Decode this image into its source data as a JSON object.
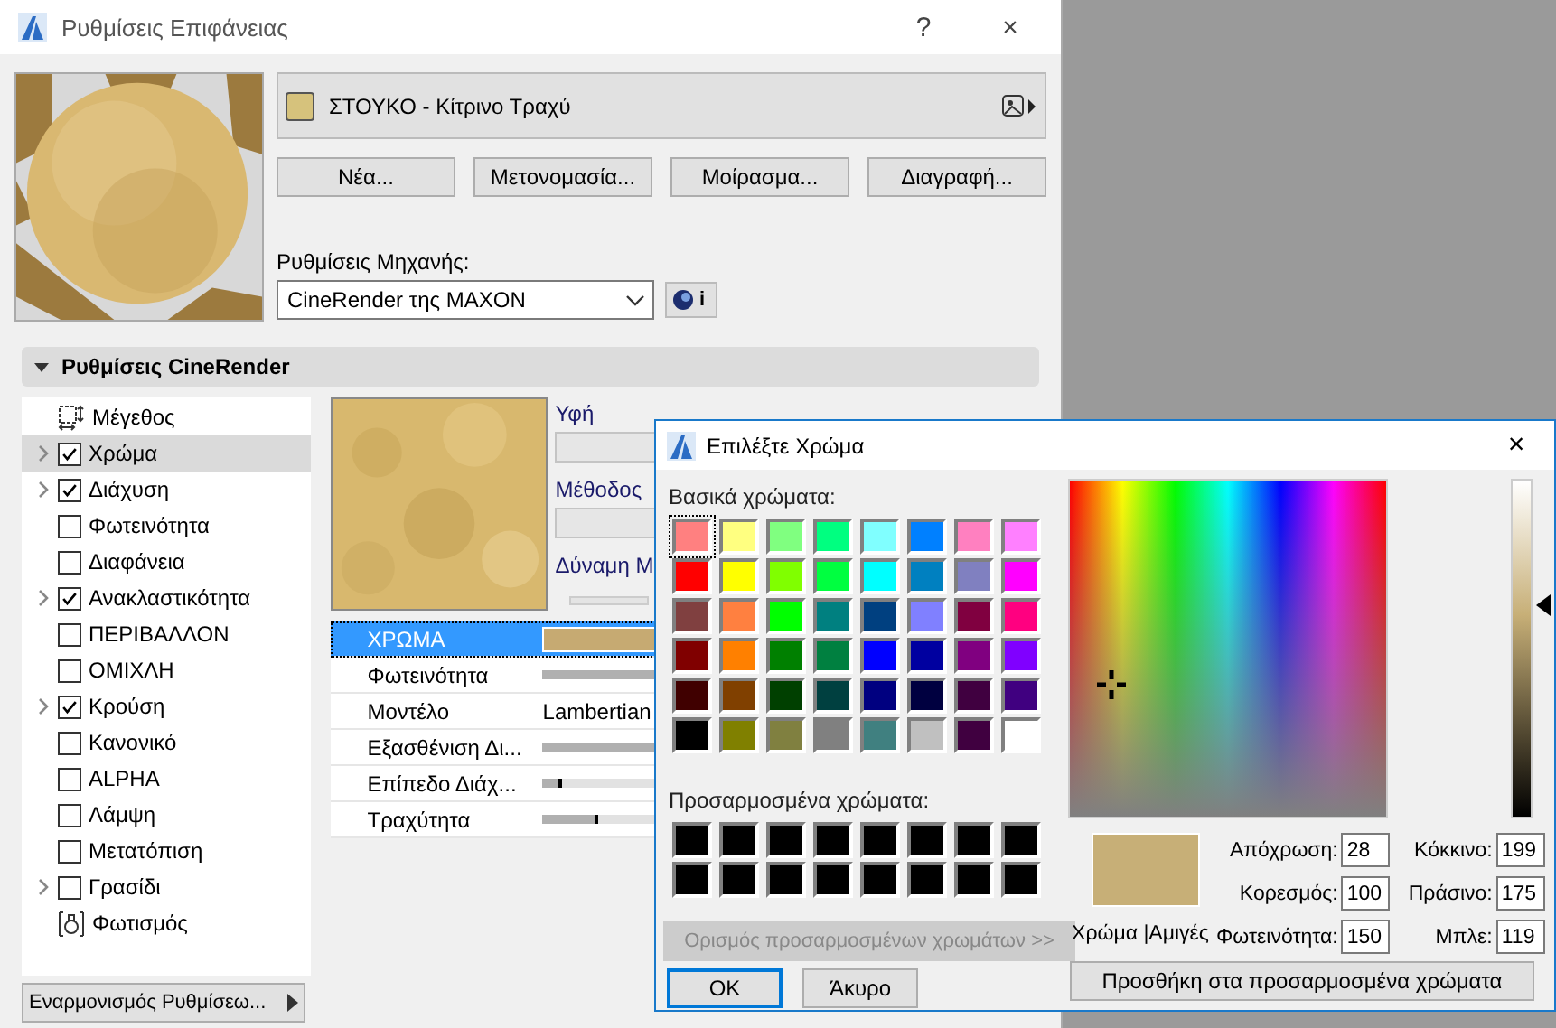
{
  "window": {
    "title": "Ρυθμίσεις Επιφάνειας",
    "help": "?",
    "close": "×"
  },
  "material": {
    "name": "ΣΤΟΥΚΟ - Κίτρινο Τραχύ"
  },
  "material_buttons": [
    "Νέα...",
    "Μετονομασία...",
    "Μοίρασμα...",
    "Διαγραφή..."
  ],
  "engine": {
    "label": "Ρυθμίσεις Μηχανής:",
    "value": "CineRender της MAXON",
    "info": "i"
  },
  "section": {
    "title": "Ρυθμίσεις CineRender",
    "expanded": true
  },
  "channels": [
    {
      "label": "Μέγεθος",
      "kind": "size",
      "expandable": false,
      "selected": false
    },
    {
      "label": "Χρώμα",
      "kind": "check",
      "checked": true,
      "expandable": true,
      "selected": true
    },
    {
      "label": "Διάχυση",
      "kind": "check",
      "checked": true,
      "expandable": true,
      "selected": false
    },
    {
      "label": "Φωτεινότητα",
      "kind": "check",
      "checked": false,
      "expandable": false,
      "selected": false
    },
    {
      "label": "Διαφάνεια",
      "kind": "check",
      "checked": false,
      "expandable": false,
      "selected": false
    },
    {
      "label": "Ανακλαστικότητα",
      "kind": "check",
      "checked": true,
      "expandable": true,
      "selected": false
    },
    {
      "label": "ΠΕΡΙΒΑΛΛΟΝ",
      "kind": "check",
      "checked": false,
      "expandable": false,
      "selected": false
    },
    {
      "label": "ΟΜΙΧΛΗ",
      "kind": "check",
      "checked": false,
      "expandable": false,
      "selected": false
    },
    {
      "label": "Κρούση",
      "kind": "check",
      "checked": true,
      "expandable": true,
      "selected": false
    },
    {
      "label": "Κανονικό",
      "kind": "check",
      "checked": false,
      "expandable": false,
      "selected": false
    },
    {
      "label": "ALPHA",
      "kind": "check",
      "checked": false,
      "expandable": false,
      "selected": false
    },
    {
      "label": "Λάμψη",
      "kind": "check",
      "checked": false,
      "expandable": false,
      "selected": false
    },
    {
      "label": "Μετατόπιση",
      "kind": "check",
      "checked": false,
      "expandable": false,
      "selected": false
    },
    {
      "label": "Γρασίδι",
      "kind": "check",
      "checked": false,
      "expandable": true,
      "selected": false
    },
    {
      "label": "Φωτισμός",
      "kind": "light",
      "expandable": false,
      "selected": false
    }
  ],
  "harmonize_button": "Εναρμονισμός Ρυθμίσεω...",
  "texture_panel": {
    "texture_label": "Υφή",
    "method_label": "Μέθοδος",
    "strength_label": "Δύναμη Μ"
  },
  "properties": [
    {
      "label": "ΧΡΩΜΑ",
      "kind": "color",
      "selected": true
    },
    {
      "label": "Φωτεινότητα",
      "kind": "slider",
      "level": 0.5,
      "selected": false
    },
    {
      "label": "Μοντέλο",
      "kind": "text",
      "value": "Lambertian",
      "selected": false
    },
    {
      "label": "Εξασθένιση Δι...",
      "kind": "slider",
      "level": 0.5,
      "selected": false
    },
    {
      "label": "Επίπεδο Διάχ...",
      "kind": "slider",
      "level": 0.06,
      "selected": false
    },
    {
      "label": "Τραχύτητα",
      "kind": "slider",
      "level": 0.17,
      "selected": false
    }
  ],
  "color_dialog": {
    "title": "Επιλέξτε Χρώμα",
    "close": "×",
    "basic_label": "Βασικά χρώματα:",
    "basic_colors": [
      {
        "color": "#ff8080",
        "selected": true
      },
      {
        "color": "#ffff80",
        "selected": false
      },
      {
        "color": "#80ff80",
        "selected": false
      },
      {
        "color": "#00ff80",
        "selected": false
      },
      {
        "color": "#80ffff",
        "selected": false
      },
      {
        "color": "#0080ff",
        "selected": false
      },
      {
        "color": "#ff80c0",
        "selected": false
      },
      {
        "color": "#ff80ff",
        "selected": false
      },
      {
        "color": "#ff0000",
        "selected": false
      },
      {
        "color": "#ffff00",
        "selected": false
      },
      {
        "color": "#80ff00",
        "selected": false
      },
      {
        "color": "#00ff40",
        "selected": false
      },
      {
        "color": "#00ffff",
        "selected": false
      },
      {
        "color": "#0080c0",
        "selected": false
      },
      {
        "color": "#8080c0",
        "selected": false
      },
      {
        "color": "#ff00ff",
        "selected": false
      },
      {
        "color": "#804040",
        "selected": false
      },
      {
        "color": "#ff8040",
        "selected": false
      },
      {
        "color": "#00ff00",
        "selected": false
      },
      {
        "color": "#008080",
        "selected": false
      },
      {
        "color": "#004080",
        "selected": false
      },
      {
        "color": "#8080ff",
        "selected": false
      },
      {
        "color": "#800040",
        "selected": false
      },
      {
        "color": "#ff0080",
        "selected": false
      },
      {
        "color": "#800000",
        "selected": false
      },
      {
        "color": "#ff8000",
        "selected": false
      },
      {
        "color": "#008000",
        "selected": false
      },
      {
        "color": "#008040",
        "selected": false
      },
      {
        "color": "#0000ff",
        "selected": false
      },
      {
        "color": "#0000a0",
        "selected": false
      },
      {
        "color": "#800080",
        "selected": false
      },
      {
        "color": "#8000ff",
        "selected": false
      },
      {
        "color": "#400000",
        "selected": false
      },
      {
        "color": "#804000",
        "selected": false
      },
      {
        "color": "#004000",
        "selected": false
      },
      {
        "color": "#004040",
        "selected": false
      },
      {
        "color": "#000080",
        "selected": false
      },
      {
        "color": "#000040",
        "selected": false
      },
      {
        "color": "#400040",
        "selected": false
      },
      {
        "color": "#400080",
        "selected": false
      },
      {
        "color": "#000000",
        "selected": false
      },
      {
        "color": "#808000",
        "selected": false
      },
      {
        "color": "#808040",
        "selected": false
      },
      {
        "color": "#808080",
        "selected": false
      },
      {
        "color": "#408080",
        "selected": false
      },
      {
        "color": "#c0c0c0",
        "selected": false
      },
      {
        "color": "#400040",
        "selected": false
      },
      {
        "color": "#ffffff",
        "selected": false
      }
    ],
    "custom_label": "Προσαρμοσμένα χρώματα:",
    "custom_colors": [
      {
        "color": "#000000"
      },
      {
        "color": "#000000"
      },
      {
        "color": "#000000"
      },
      {
        "color": "#000000"
      },
      {
        "color": "#000000"
      },
      {
        "color": "#000000"
      },
      {
        "color": "#000000"
      },
      {
        "color": "#000000"
      },
      {
        "color": "#000000"
      },
      {
        "color": "#000000"
      },
      {
        "color": "#000000"
      },
      {
        "color": "#000000"
      },
      {
        "color": "#000000"
      },
      {
        "color": "#000000"
      },
      {
        "color": "#000000"
      },
      {
        "color": "#000000"
      }
    ],
    "define_button": {
      "label": "Ορισμός προσαρμοσμένων χρωμάτων >>",
      "disabled": true
    },
    "ok": "OK",
    "cancel": "Άκυρο",
    "luminance": {
      "level": 0.63
    },
    "preview_label": "Χρώμα |Αμιγές",
    "fields": [
      {
        "label": "Απόχρωση:",
        "value": "28"
      },
      {
        "label": "Κόκκινο:",
        "value": "199"
      },
      {
        "label": "Κορεσμός:",
        "value": "100"
      },
      {
        "label": "Πράσινο:",
        "value": "175"
      },
      {
        "label": "Φωτεινότητα:",
        "value": "150"
      },
      {
        "label": "Μπλε:",
        "value": "119"
      }
    ],
    "add_button": "Προσθήκη στα προσαρμοσμένα χρώματα"
  }
}
